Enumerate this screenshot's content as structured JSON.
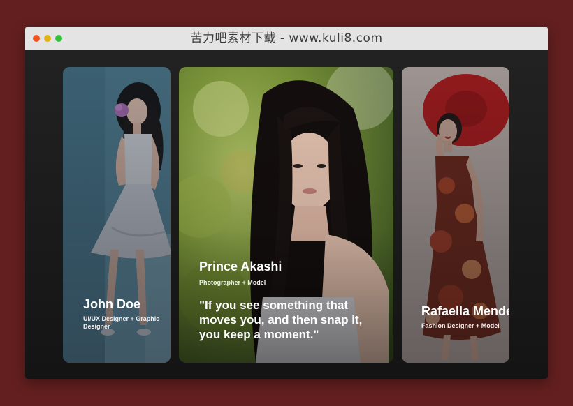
{
  "window": {
    "title": "苦力吧素材下载 - www.kuli8.com",
    "controls": [
      "close",
      "minimize",
      "zoom"
    ]
  },
  "colors": {
    "page_background": "#631f1f",
    "titlebar": "#e4e4e4",
    "content_background": "#1b1b1b",
    "close": "#f1551e",
    "minimize": "#e2b316",
    "zoom": "#35c23b"
  },
  "cards": [
    {
      "name": "John Doe",
      "role": "UI/UX Designer + Graphic Designer",
      "photo": "woman-white-dress-holding-flower-photo"
    },
    {
      "name": "Prince Akashi",
      "role": "Photographer + Model",
      "quote": "\"If you see something that moves you, and then snap it, you keep a moment.\"",
      "photo": "woman-long-black-hair-portrait-photo"
    },
    {
      "name": "Rafaella Mendes",
      "role": "Fashion Designer + Model",
      "photo": "woman-red-hat-floral-dress-photo"
    }
  ]
}
